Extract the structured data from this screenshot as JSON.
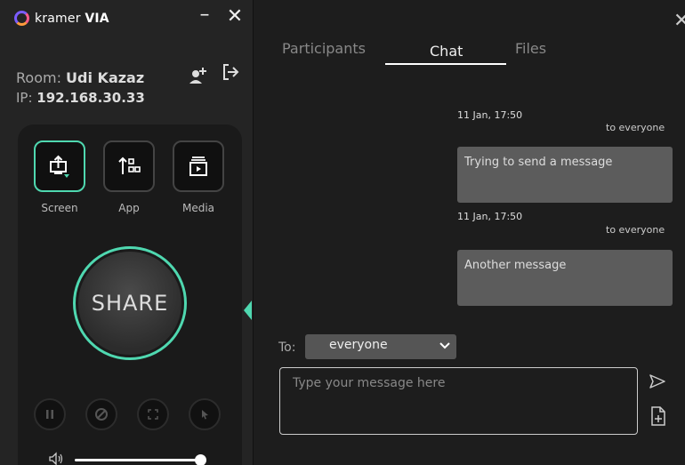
{
  "app": {
    "logo_prefix": "kramer",
    "logo_suffix": "VIA"
  },
  "room": {
    "label": "Room: ",
    "name": "Udi Kazaz",
    "ip_label": "IP: ",
    "ip": "192.168.30.33"
  },
  "sources": [
    {
      "label": "Screen",
      "icon": "screen-share-icon",
      "active": true
    },
    {
      "label": "App",
      "icon": "app-share-icon",
      "active": false
    },
    {
      "label": "Media",
      "icon": "media-icon",
      "active": false
    }
  ],
  "share_label": "SHARE",
  "controls": [
    "pause-icon",
    "stop-icon",
    "fullscreen-icon",
    "pointer-icon"
  ],
  "volume": {
    "level": 0.95
  },
  "tabs": [
    {
      "label": "Participants",
      "active": false
    },
    {
      "label": "Chat",
      "active": true
    },
    {
      "label": "Files",
      "active": false
    }
  ],
  "messages": [
    {
      "time": "11 Jan, 17:50",
      "to": "to everyone",
      "text": "Trying to send a message"
    },
    {
      "time": "11 Jan, 17:50",
      "to": "to everyone",
      "text": "Another message"
    }
  ],
  "compose": {
    "to_label": "To:",
    "recipient": "everyone",
    "placeholder": "Type your message here"
  },
  "colors": {
    "accent": "#4fd8b0",
    "bubble": "#5c5c5c"
  }
}
